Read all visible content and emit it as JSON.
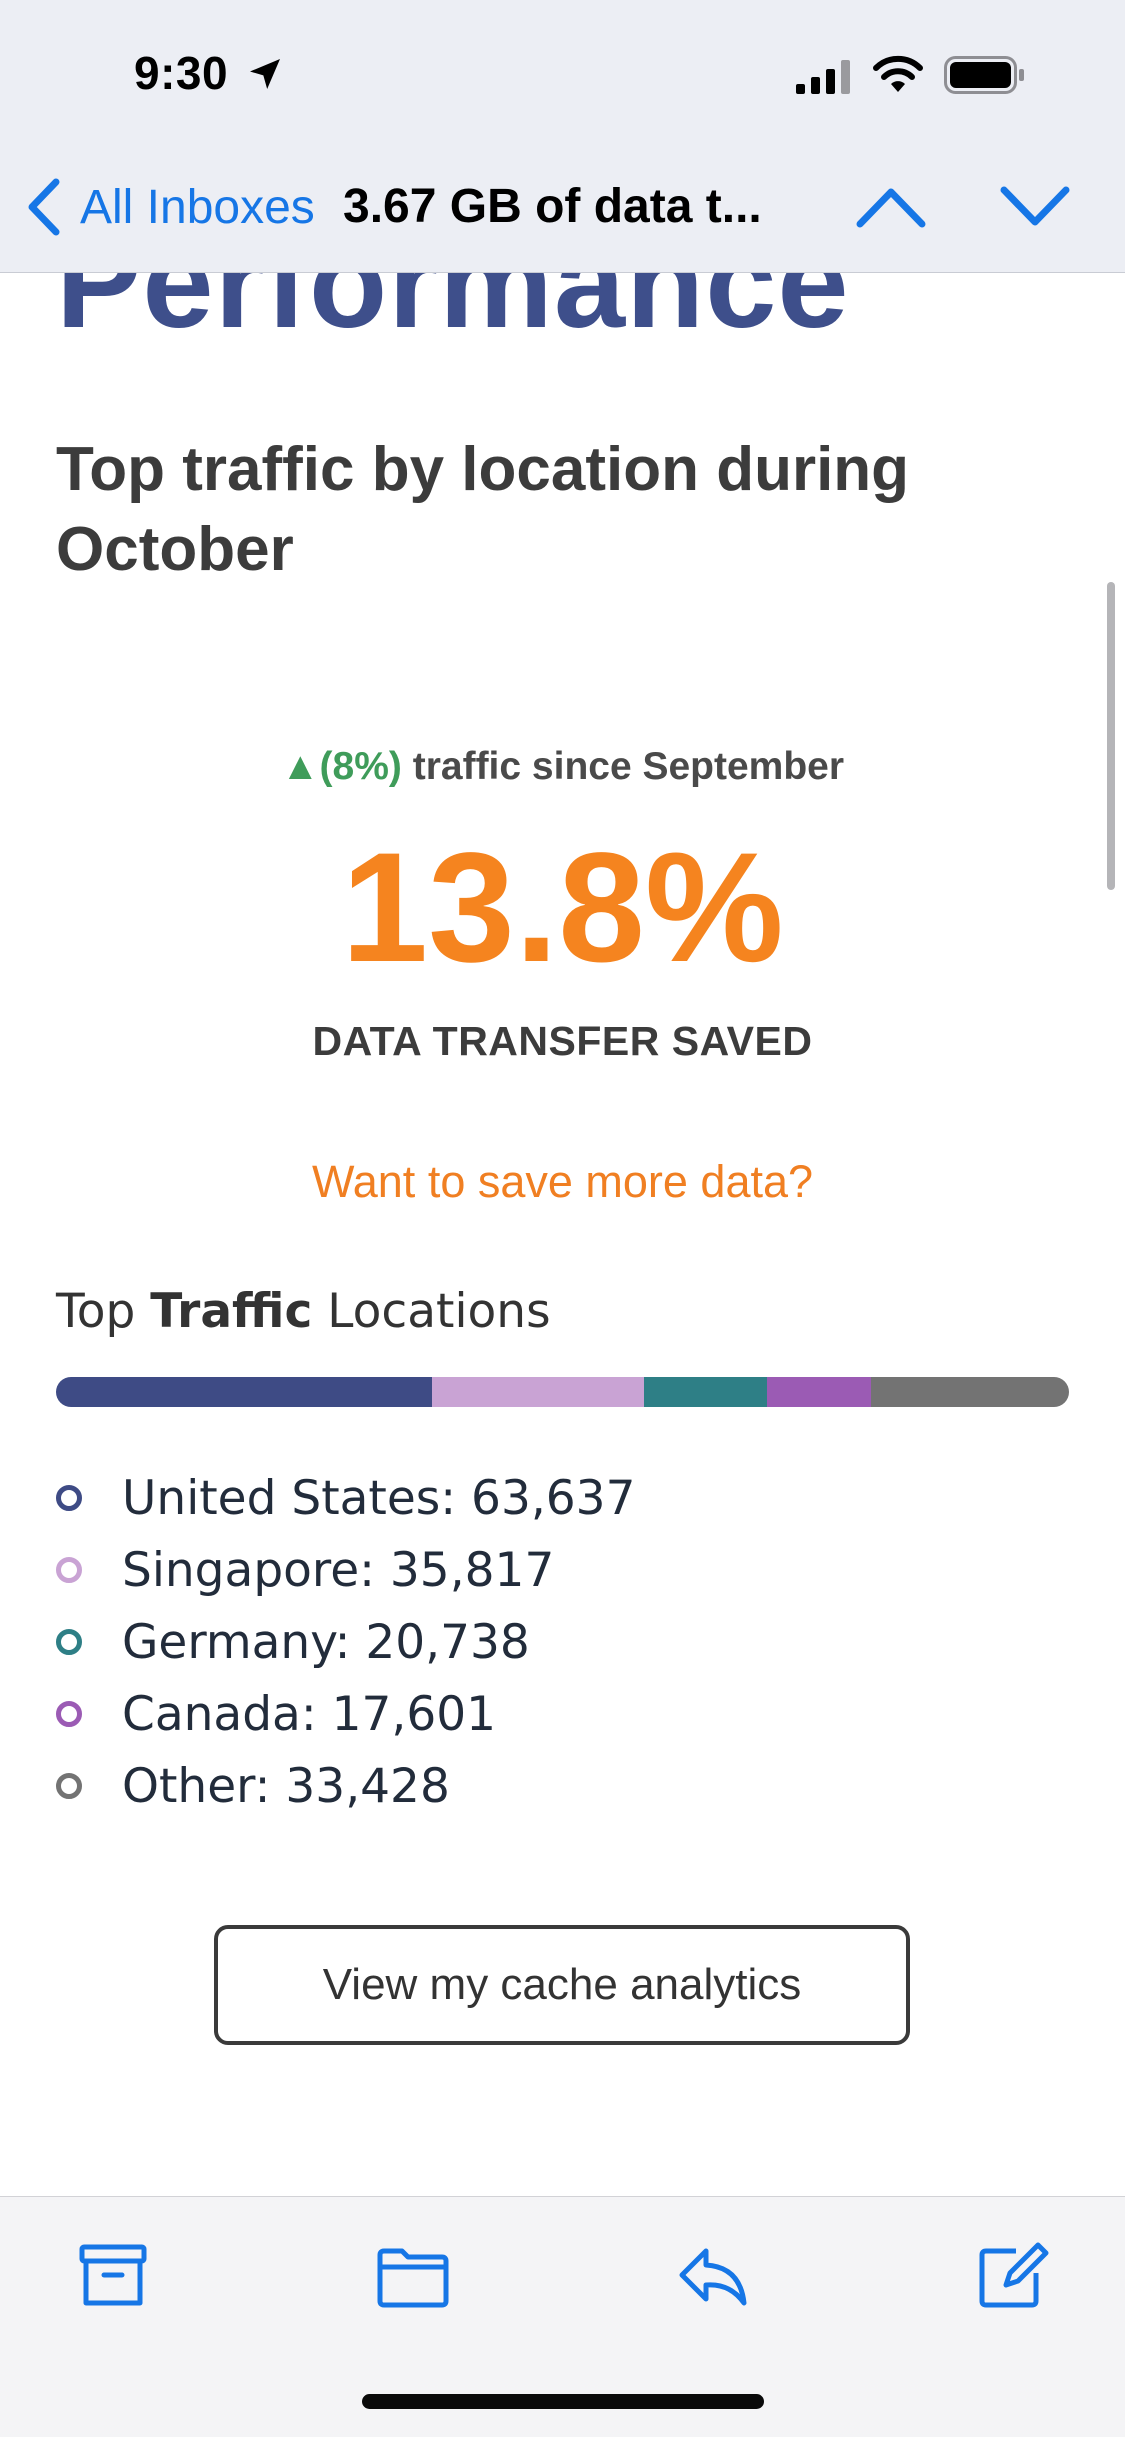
{
  "status_bar": {
    "time": "9:30",
    "icons": [
      "location-arrow-icon",
      "cellular-signal-icon",
      "wifi-icon",
      "battery-icon"
    ]
  },
  "nav": {
    "back_label": "All Inboxes",
    "title": "3.67 GB of data t...",
    "previous_icon": "chevron-up-icon",
    "next_icon": "chevron-down-icon",
    "accent_color": "#1676e6"
  },
  "email": {
    "heading_partial": "Performance",
    "section_title": "Top traffic by location during October",
    "change": {
      "prefix": "▲(8%)",
      "text": " traffic since September",
      "color": "#3f9c5a"
    },
    "big_stat": "13.8%",
    "stat_label": "DATA TRANSFER SAVED",
    "save_more_link": "Want to save more data?",
    "locations_title_pre": "Top ",
    "locations_title_bold": "Traffic",
    "locations_title_post": " Locations",
    "locations": [
      {
        "text": "United States: 63,637",
        "name": "United States",
        "value": 63637,
        "color": "#3e4b85"
      },
      {
        "text": "Singapore: 35,817",
        "name": "Singapore",
        "value": 35817,
        "color": "#c9a3d4"
      },
      {
        "text": "Germany: 20,738",
        "name": "Germany",
        "value": 20738,
        "color": "#2e7f86"
      },
      {
        "text": "Canada: 17,601",
        "name": "Canada",
        "value": 17601,
        "color": "#9b5bb4"
      },
      {
        "text": "Other: 33,428",
        "name": "Other",
        "value": 33428,
        "color": "#737373"
      }
    ],
    "cache_button": "View my cache analytics"
  },
  "toolbar": {
    "icons": [
      "archive-icon",
      "folder-icon",
      "reply-icon",
      "compose-icon"
    ]
  }
}
